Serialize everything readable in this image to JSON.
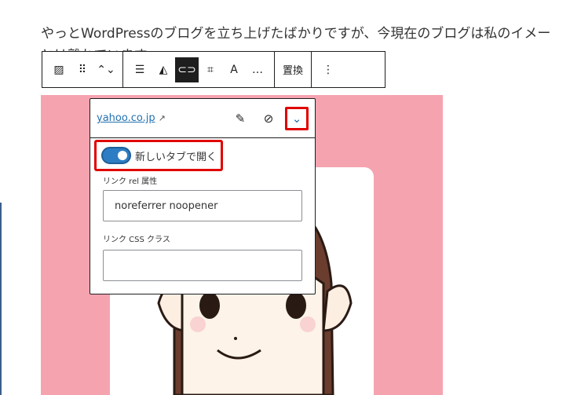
{
  "paragraph": {
    "line1": "やっとWordPressのブログを立ち上げたばかりですが、今現在のブログは私のイメー",
    "line2": "とは離れています。"
  },
  "toolbar": {
    "items": [
      {
        "name": "image-icon",
        "glyph": "▨"
      },
      {
        "name": "drag-handle-icon",
        "glyph": "⠿"
      },
      {
        "name": "move-up-down-icon",
        "glyph": "⌃⌄"
      },
      {
        "name": "align-icon",
        "glyph": "☰"
      },
      {
        "name": "duotone-icon",
        "glyph": "◭"
      },
      {
        "name": "link-icon",
        "glyph": "⊂⊃"
      },
      {
        "name": "crop-icon",
        "glyph": "⌗"
      },
      {
        "name": "text-overlay-icon",
        "glyph": "A"
      },
      {
        "name": "caption-icon",
        "glyph": "…"
      }
    ],
    "replace_label": "置換",
    "more_glyph": "⋮"
  },
  "popover": {
    "url": "yahoo.co.jp",
    "ext_glyph": "↗",
    "edit_glyph": "✎",
    "unlink_glyph": "⊘",
    "chevron_glyph": "⌄",
    "toggle_label": "新しいタブで開く",
    "toggle_on": true,
    "rel_label": "リンク rel 属性",
    "rel_value": "noreferrer noopener",
    "css_label": "リンク CSS クラス",
    "css_value": ""
  },
  "colors": {
    "accent": "#2d7dc4",
    "highlight": "#e00000",
    "image_bg": "#f6a3b0"
  }
}
